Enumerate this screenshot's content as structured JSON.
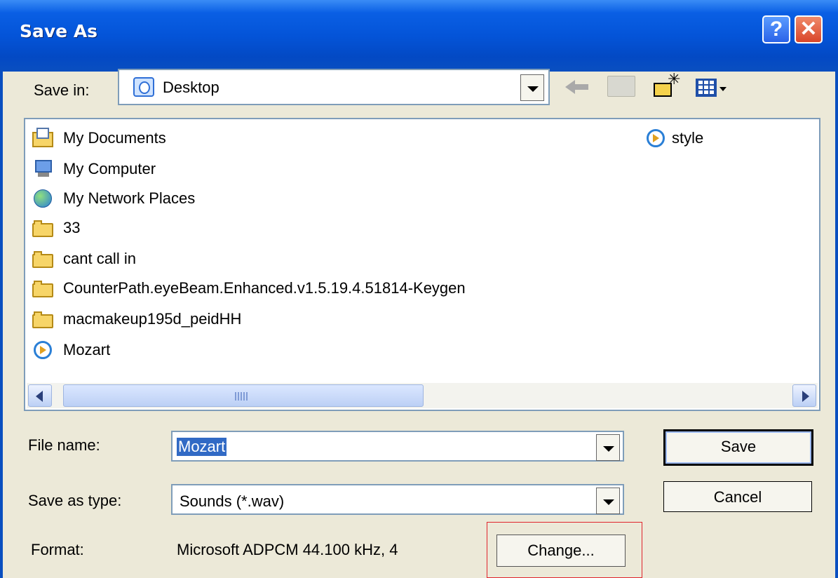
{
  "window": {
    "title": "Save As"
  },
  "titlebar": {
    "help_glyph": "?",
    "close_glyph": "✕"
  },
  "toolbar": {
    "save_in_label": "Save in:",
    "save_in_value": "Desktop",
    "icons": [
      "back-arrow-icon",
      "up-folder-icon",
      "new-folder-icon",
      "views-menu-icon"
    ]
  },
  "file_list": {
    "items": [
      {
        "name": "My Documents",
        "icon": "my-documents-icon"
      },
      {
        "name": "My Computer",
        "icon": "my-computer-icon"
      },
      {
        "name": "My Network Places",
        "icon": "network-places-icon"
      },
      {
        "name": "33",
        "icon": "folder-icon"
      },
      {
        "name": "cant call in",
        "icon": "folder-icon"
      },
      {
        "name": "CounterPath.eyeBeam.Enhanced.v1.5.19.4.51814-Keygen",
        "icon": "folder-icon"
      },
      {
        "name": "macmakeup195d_peidHH",
        "icon": "folder-icon"
      },
      {
        "name": "Mozart",
        "icon": "media-file-icon"
      },
      {
        "name": "style",
        "icon": "media-file-icon"
      }
    ]
  },
  "form": {
    "file_name_label": "File name:",
    "file_name_value": "Mozart",
    "save_as_type_label": "Save as type:",
    "save_as_type_value": "Sounds (*.wav)",
    "format_label": "Format:",
    "format_value": "Microsoft ADPCM 44.100 kHz, 4",
    "change_button": "Change..."
  },
  "buttons": {
    "save": "Save",
    "cancel": "Cancel"
  },
  "colors": {
    "titlebar": "#0454d8",
    "dialog_bg": "#ece9d8",
    "selection": "#316ac5",
    "highlight_box": "#e0242c"
  }
}
